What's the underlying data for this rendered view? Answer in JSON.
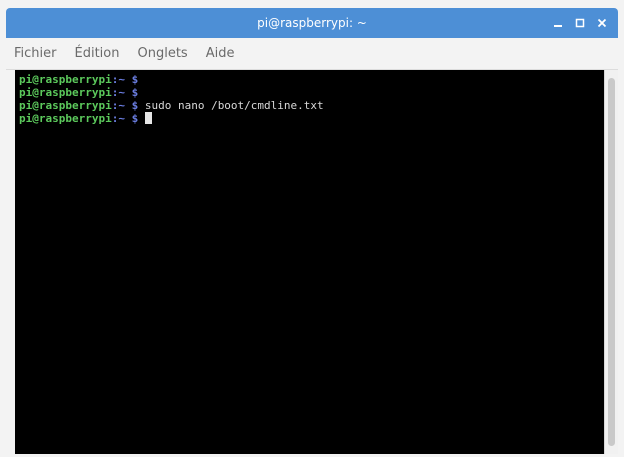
{
  "window": {
    "title": "pi@raspberrypi: ~"
  },
  "menu": {
    "items": [
      "Fichier",
      "Édition",
      "Onglets",
      "Aide"
    ]
  },
  "terminal": {
    "lines": [
      {
        "prompt": "pi@raspberrypi",
        "path": ":~ $",
        "command": ""
      },
      {
        "prompt": "pi@raspberrypi",
        "path": ":~ $",
        "command": ""
      },
      {
        "prompt": "pi@raspberrypi",
        "path": ":~ $",
        "command": " sudo nano /boot/cmdline.txt"
      },
      {
        "prompt": "pi@raspberrypi",
        "path": ":~ $",
        "command": " "
      }
    ]
  },
  "icons": {
    "minimize": "minimize-icon",
    "maximize": "maximize-icon",
    "close": "close-icon"
  },
  "colors": {
    "titlebar": "#4d8fd6",
    "prompt": "#5cc95c",
    "path": "#6a7de0",
    "terminal_bg": "#000000"
  }
}
